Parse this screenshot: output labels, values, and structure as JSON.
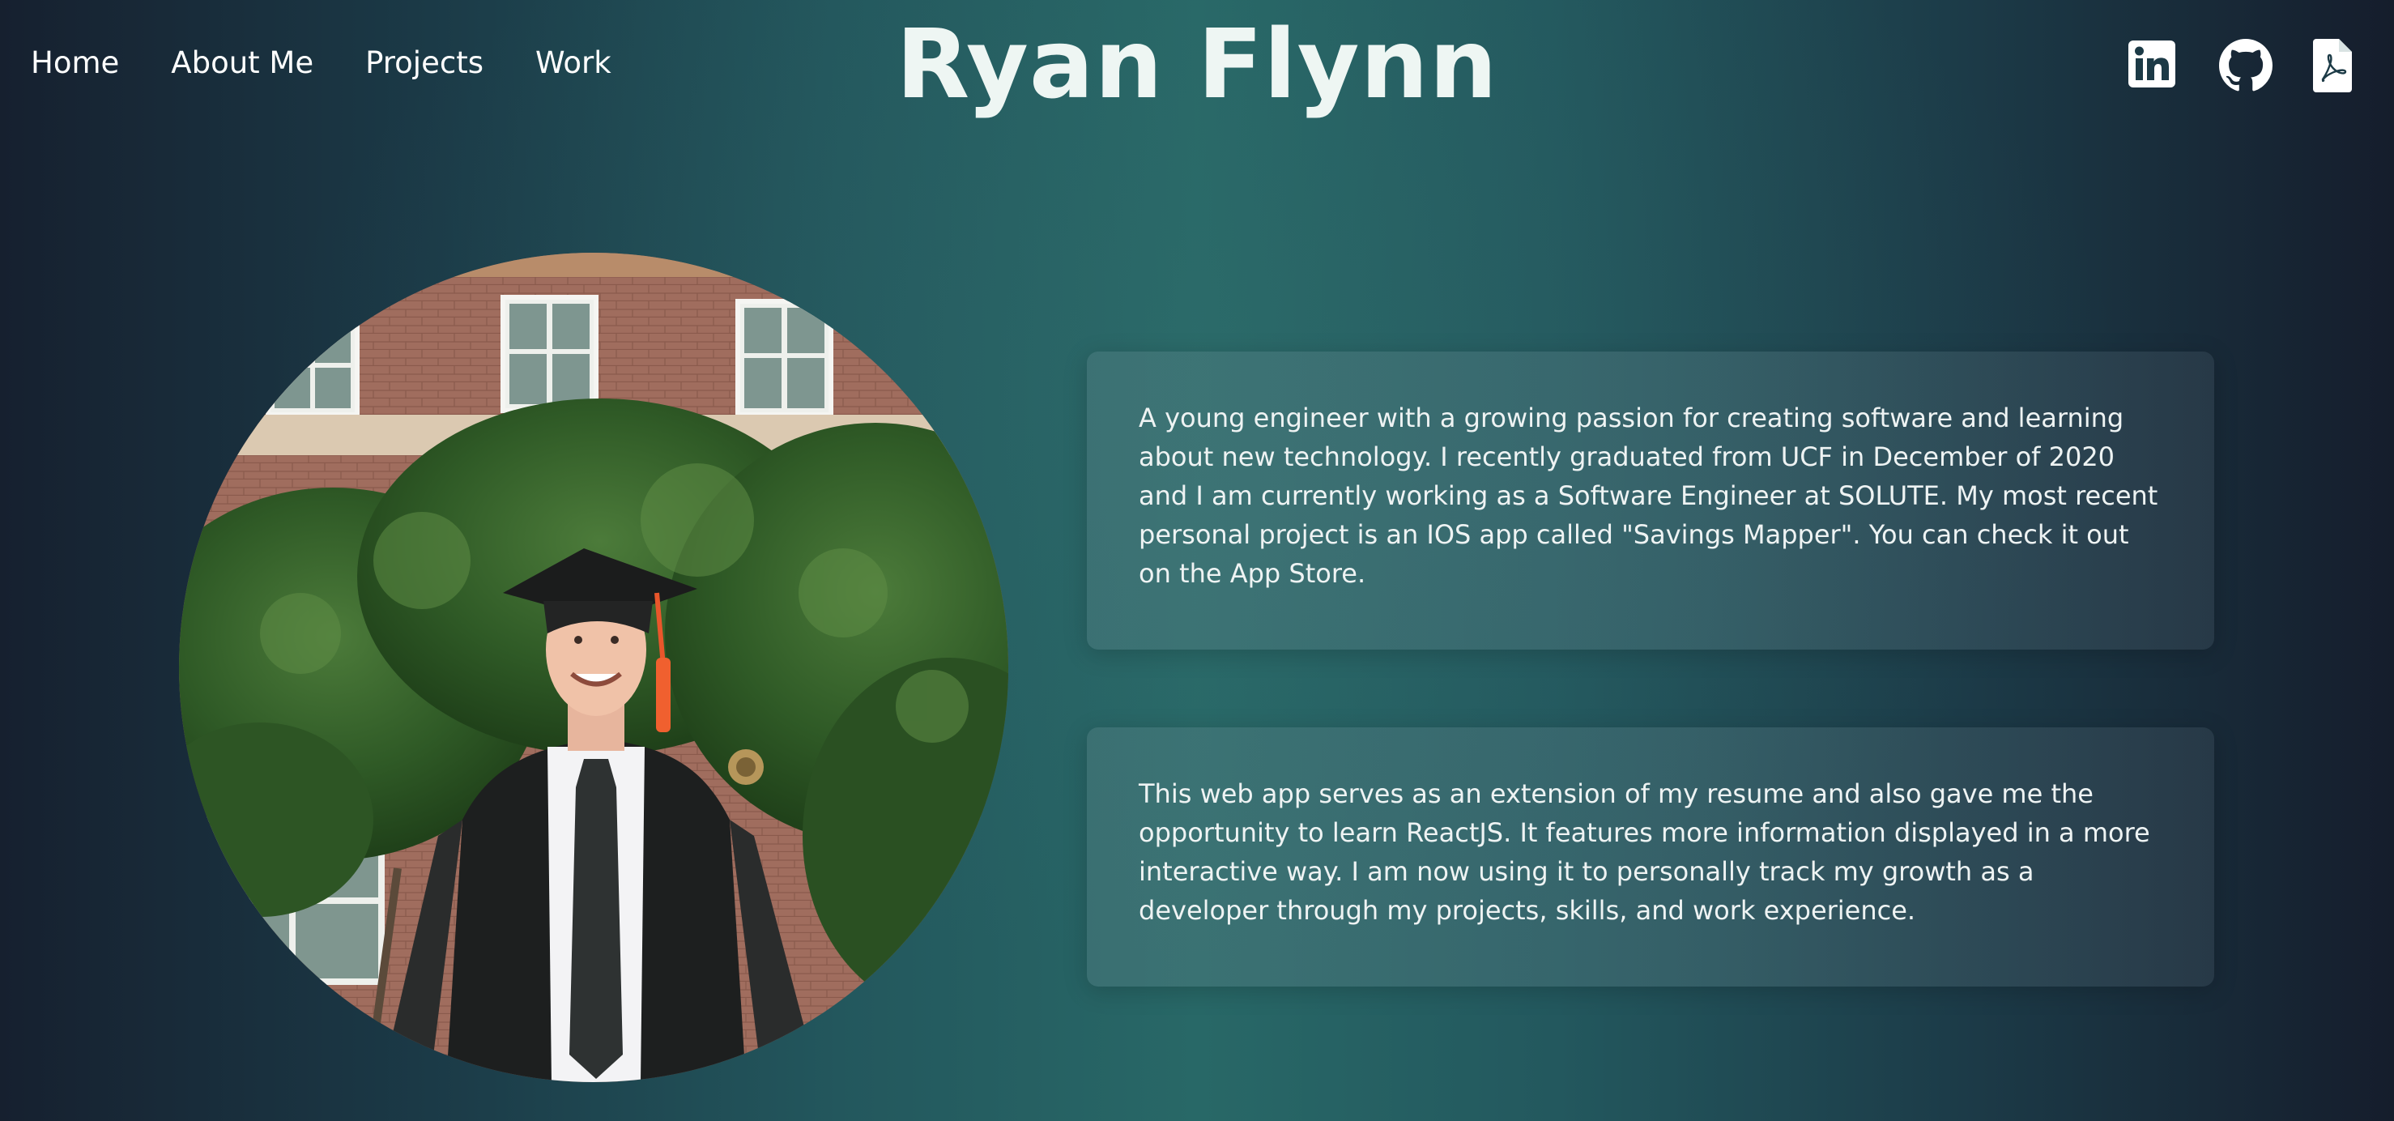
{
  "nav": {
    "items": [
      {
        "label": "Home"
      },
      {
        "label": "About Me"
      },
      {
        "label": "Projects"
      },
      {
        "label": "Work"
      }
    ]
  },
  "header": {
    "title": "Ryan Flynn"
  },
  "socials": [
    {
      "icon": "linkedin-icon"
    },
    {
      "icon": "github-icon"
    },
    {
      "icon": "pdf-resume-icon"
    }
  ],
  "about": {
    "paragraph_1": "A young engineer with a growing passion for creating software and learning about new technology. I recently graduated from UCF in December of 2020 and I am currently working as a Software Engineer at SOLUTE. My most recent personal project is an IOS app called \"Savings Mapper\". You can check it out on the App Store.",
    "paragraph_2": "This web app serves as an extension of my resume and also gave me the opportunity to learn ReactJS. It features more information displayed in a more interactive way. I am now using it to personally track my growth as a developer through my projects, skills, and work experience."
  },
  "colors": {
    "background_center": "#286867",
    "background_edge": "#16202f",
    "title": "#eef6f3",
    "text": "#ffffff"
  }
}
